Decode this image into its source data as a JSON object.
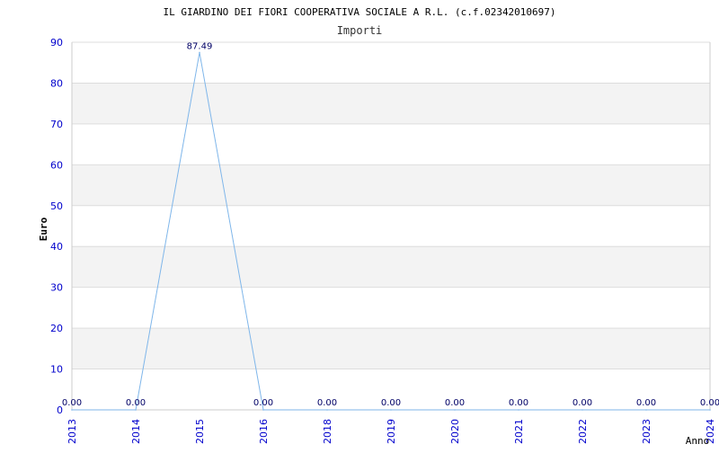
{
  "chart_data": {
    "type": "line",
    "title": "IL GIARDINO DEI FIORI COOPERATIVA SOCIALE A R.L. (c.f.02342010697)",
    "subtitle": "Importi",
    "xlabel": "Anno",
    "ylabel": "Euro",
    "categories": [
      "2013",
      "2014",
      "2015",
      "2016",
      "2018",
      "2019",
      "2020",
      "2021",
      "2022",
      "2023",
      "2024"
    ],
    "series": [
      {
        "values": [
          0,
          0,
          87.49,
          0,
          0,
          0,
          0,
          0,
          0,
          0,
          0
        ]
      }
    ],
    "data_labels": [
      "0.00",
      "0.00",
      "87.49",
      "0.00",
      "0.00",
      "0.00",
      "0.00",
      "0.00",
      "0.00",
      "0.00",
      "0.00"
    ],
    "ylim": [
      0,
      90
    ],
    "yticks": [
      0,
      10,
      20,
      30,
      40,
      50,
      60,
      70,
      80,
      90
    ],
    "grid": true,
    "legend": "none",
    "colors": {
      "line": "#7fb6ea",
      "axis_text": "#0000cc",
      "band": "#f3f3f3",
      "grid": "#dddddd",
      "title": "#000000",
      "label": "#000000",
      "data_label": "#000066"
    }
  }
}
